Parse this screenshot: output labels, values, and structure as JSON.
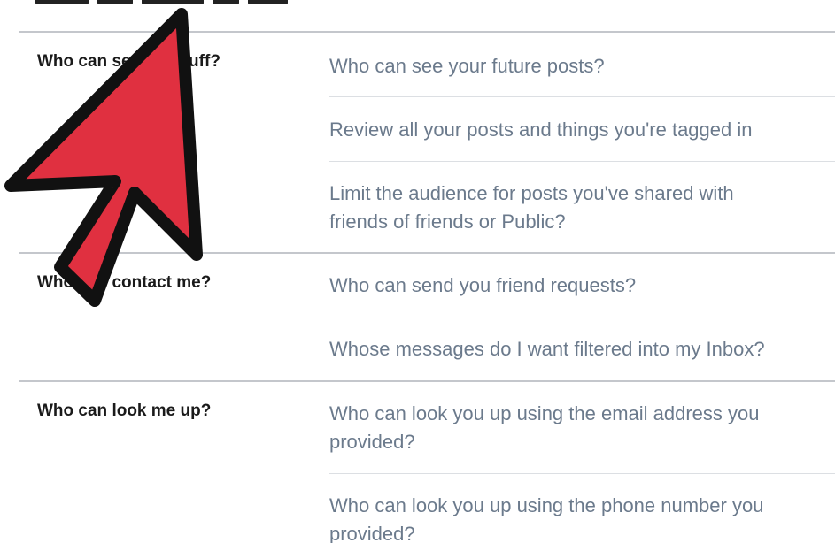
{
  "sections": [
    {
      "title": "Who can see my stuff?",
      "settings": [
        {
          "lines": [
            "Who can see your future posts?"
          ]
        },
        {
          "lines": [
            "Review all your posts and things you're tagged in"
          ]
        },
        {
          "lines": [
            "Limit the audience for posts you've shared with",
            "friends of friends or Public?"
          ]
        }
      ]
    },
    {
      "title": "Who can contact me?",
      "settings": [
        {
          "lines": [
            "Who can send you friend requests?"
          ]
        },
        {
          "lines": [
            "Whose messages do I want filtered into my Inbox?"
          ]
        }
      ]
    },
    {
      "title": "Who can look me up?",
      "settings": [
        {
          "lines": [
            "Who can look you up using the email address you",
            "provided?"
          ]
        },
        {
          "lines": [
            "Who can look you up using the phone number you",
            "provided?"
          ]
        }
      ]
    }
  ],
  "overlay": {
    "icon": "red-pointer-arrow-icon",
    "fill_color": "#e03040",
    "outline_color": "#111111"
  }
}
